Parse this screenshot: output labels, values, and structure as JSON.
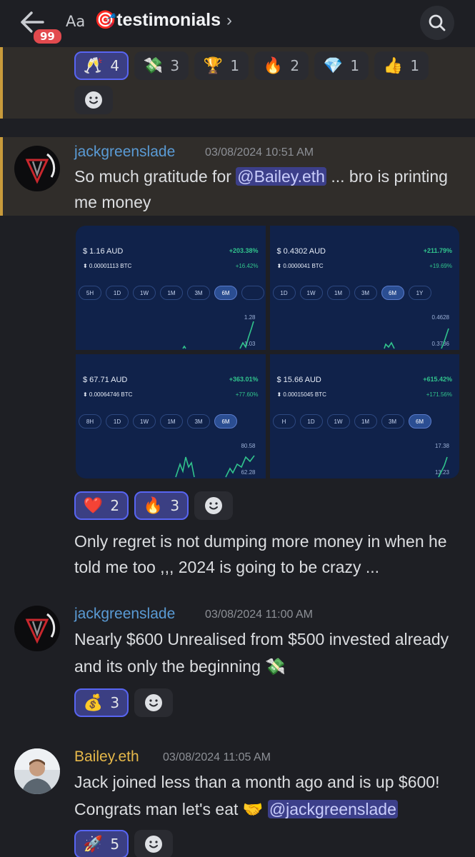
{
  "header": {
    "unread_badge": "99",
    "aa_label": "Aa",
    "channel_emoji": "🎯",
    "channel_name": "testimonials",
    "chevron": "›"
  },
  "prev_reactions": [
    {
      "emoji": "🥂",
      "count": "4",
      "me": true
    },
    {
      "emoji": "💸",
      "count": "3",
      "me": false
    },
    {
      "emoji": "🏆",
      "count": "1",
      "me": false
    },
    {
      "emoji": "🔥",
      "count": "2",
      "me": false
    },
    {
      "emoji": "💎",
      "count": "1",
      "me": false
    },
    {
      "emoji": "👍",
      "count": "1",
      "me": false
    }
  ],
  "messages": [
    {
      "username": "jackgreenslade",
      "timestamp": "03/08/2024 10:51 AM",
      "text_before": "So much gratitude for ",
      "mention": "@Bailey.eth",
      "text_after": " ... bro is printing me money",
      "reactions": [
        {
          "emoji": "❤️",
          "count": "2"
        },
        {
          "emoji": "🔥",
          "count": "3"
        }
      ],
      "followup": "Only regret is not dumping more money in when he told me too ,,, 2024 is going to be crazy ..."
    },
    {
      "username": "jackgreenslade",
      "timestamp": "03/08/2024 11:00 AM",
      "text": "Nearly $600 Unrealised from $500 invested already and its only the beginning 💸",
      "reactions": [
        {
          "emoji": "💰",
          "count": "3"
        }
      ]
    },
    {
      "username": "Bailey.eth",
      "timestamp": "03/08/2024 11:05 AM",
      "text": "Jack joined less than a month ago and is up $600! Congrats man let's eat 🤝 ",
      "mention": "@jackgreenslade",
      "reactions": [
        {
          "emoji": "🚀",
          "count": "5"
        }
      ]
    }
  ],
  "cards": [
    {
      "price": "$ 1.16 AUD",
      "pct": "+203.38%",
      "btc": "⬍ 0.00001113 BTC",
      "pct2": "+16.42%",
      "tfs": [
        "5H",
        "1D",
        "1W",
        "1M",
        "3M",
        "6M",
        ""
      ],
      "hi": "1.28",
      "lo": "1.03"
    },
    {
      "price": "$ 0.4302 AUD",
      "pct": "+211.79%",
      "btc": "⬍ 0.0000041 BTC",
      "pct2": "+19.69%",
      "tfs": [
        "1D",
        "1W",
        "1M",
        "3M",
        "6M",
        "1Y"
      ],
      "hi": "0.4628",
      "lo": "0.3736"
    },
    {
      "price": "$ 67.71 AUD",
      "pct": "+363.01%",
      "btc": "⬍ 0.00064746 BTC",
      "pct2": "+77.60%",
      "tfs": [
        "8H",
        "1D",
        "1W",
        "1M",
        "3M",
        "6M"
      ],
      "hi": "80.58",
      "lo": "62.28"
    },
    {
      "price": "$ 15.66 AUD",
      "pct": "+615.42%",
      "btc": "⬍ 0.00015045 BTC",
      "pct2": "+171.56%",
      "tfs": [
        "H",
        "1D",
        "1W",
        "1M",
        "3M",
        "6M"
      ],
      "hi": "17.38",
      "lo": "13.23"
    }
  ]
}
